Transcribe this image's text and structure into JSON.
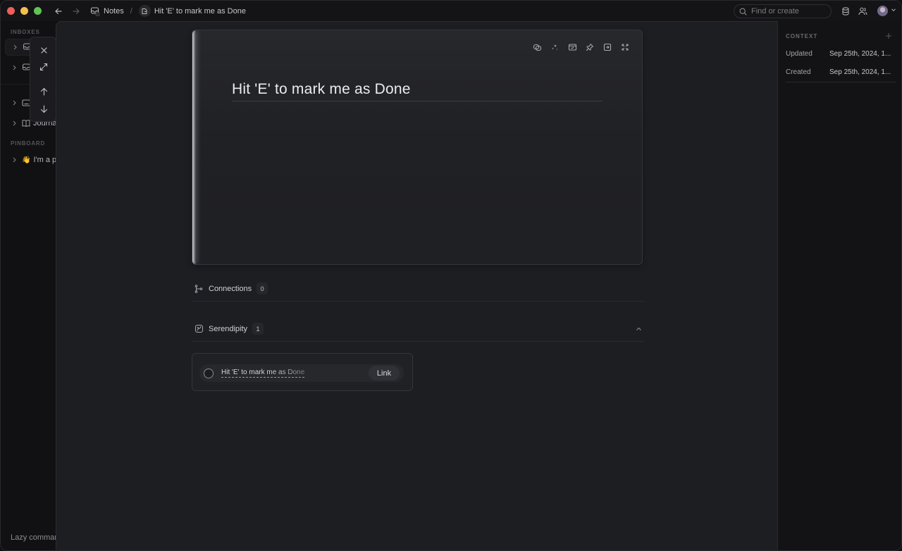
{
  "titlebar": {
    "breadcrumb": [
      {
        "label": "Notes",
        "icon": "inbox-icon"
      },
      {
        "label": "Hit 'E' to mark me as Done",
        "icon": "document-icon"
      }
    ],
    "separator": "/",
    "search_placeholder": "Find or create"
  },
  "sidebar": {
    "sections": {
      "inboxes": "INBOXES",
      "pinboard": "PINBOARD"
    },
    "items": [
      {
        "label": "",
        "icon": "inbox-icon"
      },
      {
        "label": "",
        "icon": "inbox-check-icon"
      },
      {
        "label": "",
        "icon": "calendar-icon"
      },
      {
        "label": "Journal",
        "icon": "book-icon"
      },
      {
        "label": "I'm a p",
        "icon": "waving-hand-icon",
        "emoji": "👋"
      }
    ],
    "footer": "Lazy comman"
  },
  "floating_toolbar": [
    "close",
    "expand",
    "previous",
    "next"
  ],
  "note": {
    "title": "Hit 'E' to mark me as Done",
    "toolbar": [
      "link",
      "ai-sparkle",
      "calendar",
      "pin",
      "move-to",
      "focus"
    ]
  },
  "sections": {
    "connections": {
      "label": "Connections",
      "count": "0"
    },
    "serendipity": {
      "label": "Serendipity",
      "count": "1"
    }
  },
  "suggestion": {
    "text": "Hit 'E' to mark me as Done",
    "action": "Link"
  },
  "context": {
    "header": "CONTEXT",
    "rows": [
      {
        "key": "Updated",
        "value": "Sep 25th, 2024, 1..."
      },
      {
        "key": "Created",
        "value": "Sep 25th, 2024, 1..."
      }
    ]
  }
}
